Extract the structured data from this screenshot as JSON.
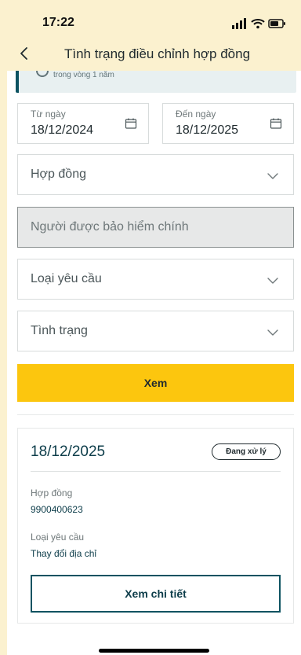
{
  "status_bar": {
    "time": "17:22",
    "icons": [
      "signal-icon",
      "wifi-icon",
      "battery-icon"
    ]
  },
  "header": {
    "title": "Tình trạng điều chỉnh hợp đồng",
    "back_icon": "chevron-left-icon"
  },
  "notice": {
    "text": "trong vòng 1 năm"
  },
  "filters": {
    "from_date": {
      "label": "Từ ngày",
      "value": "18/12/2024",
      "icon": "calendar-icon"
    },
    "to_date": {
      "label": "Đến ngày",
      "value": "18/12/2025",
      "icon": "calendar-icon"
    },
    "contract": {
      "placeholder": "Hợp đồng",
      "icon": "chevron-down-icon"
    },
    "insured": {
      "placeholder": "Người được bảo hiểm chính"
    },
    "request_type": {
      "placeholder": "Loại yêu cầu",
      "icon": "chevron-down-icon"
    },
    "status": {
      "placeholder": "Tình trạng",
      "icon": "chevron-down-icon"
    }
  },
  "actions": {
    "view_label": "Xem"
  },
  "result": {
    "date": "18/12/2025",
    "status": "Đang xử lý",
    "contract_label": "Hợp đồng",
    "contract_value": "9900400623",
    "request_type_label": "Loại yêu cầu",
    "request_type_value": "Thay đổi địa chỉ",
    "detail_label": "Xem chi tiết"
  },
  "colors": {
    "top_bar": "#fbf1cf",
    "primary_yellow": "#fcc60e",
    "primary_teal": "#0d5361",
    "text_dark": "#1f2a2e"
  }
}
